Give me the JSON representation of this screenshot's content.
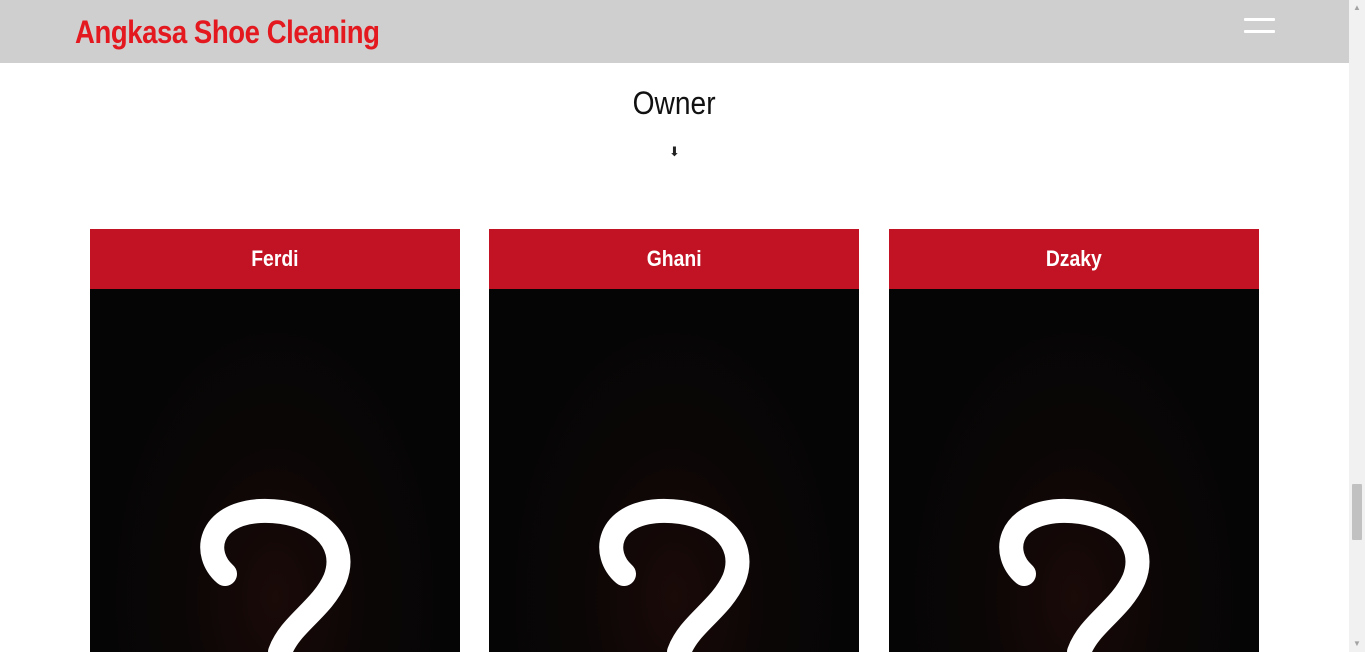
{
  "navbar": {
    "brand": "Angkasa Shoe Cleaning",
    "menu_icon": "hamburger-menu-icon",
    "background_color": "#cfcfcf",
    "brand_color": "#e3191f"
  },
  "owner_section": {
    "title": "Owner",
    "arrow": "⬇",
    "arrow_icon": "arrow-down-icon",
    "cards": [
      {
        "name": "Ferdi",
        "image_icon": "question-mark-image"
      },
      {
        "name": "Ghani",
        "image_icon": "question-mark-image"
      },
      {
        "name": "Dzaky",
        "image_icon": "question-mark-image"
      }
    ],
    "card_header_color": "#c21324"
  },
  "scrollbar": {
    "up_arrow": "▲",
    "down_arrow": "▼"
  }
}
